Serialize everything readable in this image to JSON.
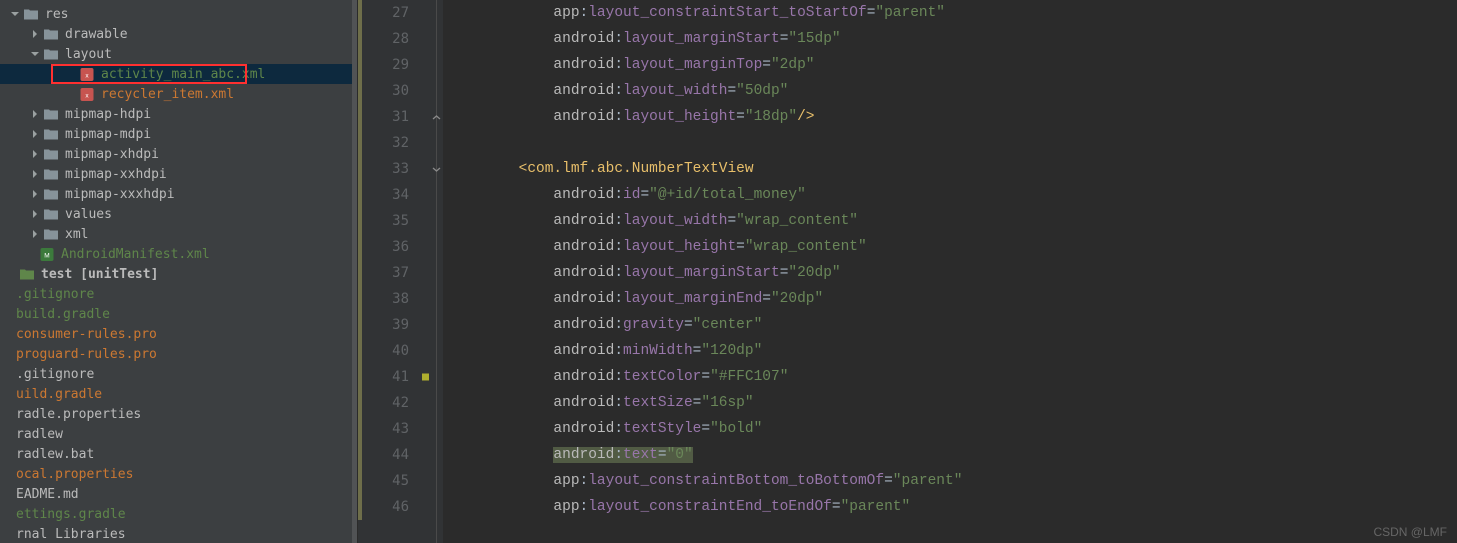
{
  "sidebar": {
    "items": [
      {
        "indent": 8,
        "chevron": "down",
        "icon": "folder",
        "label": "res"
      },
      {
        "indent": 28,
        "chevron": "right",
        "icon": "folder",
        "label": "drawable"
      },
      {
        "indent": 28,
        "chevron": "down",
        "icon": "folder",
        "label": "layout"
      },
      {
        "indent": 64,
        "chevron": "none",
        "icon": "xml-file",
        "label": "activity_main_abc.xml",
        "color": "green",
        "selected": true,
        "redbox": true
      },
      {
        "indent": 64,
        "chevron": "none",
        "icon": "xml-file",
        "label": "recycler_item.xml",
        "color": "orange"
      },
      {
        "indent": 28,
        "chevron": "right",
        "icon": "folder",
        "label": "mipmap-hdpi"
      },
      {
        "indent": 28,
        "chevron": "right",
        "icon": "folder",
        "label": "mipmap-mdpi"
      },
      {
        "indent": 28,
        "chevron": "right",
        "icon": "folder",
        "label": "mipmap-xhdpi"
      },
      {
        "indent": 28,
        "chevron": "right",
        "icon": "folder",
        "label": "mipmap-xxhdpi"
      },
      {
        "indent": 28,
        "chevron": "right",
        "icon": "folder",
        "label": "mipmap-xxxhdpi"
      },
      {
        "indent": 28,
        "chevron": "right",
        "icon": "folder",
        "label": "values"
      },
      {
        "indent": 28,
        "chevron": "right",
        "icon": "folder",
        "label": "xml"
      },
      {
        "indent": 24,
        "chevron": "none",
        "icon": "manifest",
        "label": "AndroidManifest.xml",
        "color": "green"
      },
      {
        "indent": 4,
        "chevron": "none",
        "icon": "folder-sm",
        "label": "test [unitTest]",
        "bold": true
      },
      {
        "indent": 0,
        "chevron": "none",
        "icon": "none",
        "label": ".gitignore",
        "color": "green"
      },
      {
        "indent": 0,
        "chevron": "none",
        "icon": "none",
        "label": "build.gradle",
        "color": "green"
      },
      {
        "indent": 0,
        "chevron": "none",
        "icon": "none",
        "label": "consumer-rules.pro",
        "color": "orange"
      },
      {
        "indent": 0,
        "chevron": "none",
        "icon": "none",
        "label": "proguard-rules.pro",
        "color": "orange"
      },
      {
        "indent": 0,
        "chevron": "none",
        "icon": "none",
        "label": ".gitignore"
      },
      {
        "indent": 0,
        "chevron": "none",
        "icon": "none",
        "label": "uild.gradle",
        "color": "orange"
      },
      {
        "indent": 0,
        "chevron": "none",
        "icon": "none",
        "label": "radle.properties"
      },
      {
        "indent": 0,
        "chevron": "none",
        "icon": "none",
        "label": "radlew"
      },
      {
        "indent": 0,
        "chevron": "none",
        "icon": "none",
        "label": "radlew.bat"
      },
      {
        "indent": 0,
        "chevron": "none",
        "icon": "none",
        "label": "ocal.properties",
        "color": "orange"
      },
      {
        "indent": 0,
        "chevron": "none",
        "icon": "none",
        "label": "EADME.md"
      },
      {
        "indent": 0,
        "chevron": "none",
        "icon": "none",
        "label": "ettings.gradle",
        "color": "green"
      },
      {
        "indent": 0,
        "chevron": "none",
        "icon": "none",
        "label": "rnal Libraries"
      }
    ]
  },
  "gutter": {
    "lines": [
      27,
      28,
      29,
      30,
      31,
      32,
      33,
      34,
      35,
      36,
      37,
      38,
      39,
      40,
      41,
      42,
      43,
      44,
      45,
      46
    ],
    "warnLine": 41,
    "collapseOpen": 31,
    "collapseStart": 33
  },
  "code": [
    {
      "indent": 12,
      "tokens": [
        {
          "t": "ns",
          "v": "app"
        },
        {
          "t": "eq",
          "v": ":"
        },
        {
          "t": "attr",
          "v": "layout_constraintStart_toStartOf"
        },
        {
          "t": "eq",
          "v": "="
        },
        {
          "t": "str",
          "v": "\"parent\""
        }
      ]
    },
    {
      "indent": 12,
      "tokens": [
        {
          "t": "ns",
          "v": "android"
        },
        {
          "t": "eq",
          "v": ":"
        },
        {
          "t": "attr",
          "v": "layout_marginStart"
        },
        {
          "t": "eq",
          "v": "="
        },
        {
          "t": "str",
          "v": "\"15dp\""
        }
      ]
    },
    {
      "indent": 12,
      "tokens": [
        {
          "t": "ns",
          "v": "android"
        },
        {
          "t": "eq",
          "v": ":"
        },
        {
          "t": "attr",
          "v": "layout_marginTop"
        },
        {
          "t": "eq",
          "v": "="
        },
        {
          "t": "str",
          "v": "\"2dp\""
        }
      ]
    },
    {
      "indent": 12,
      "tokens": [
        {
          "t": "ns",
          "v": "android"
        },
        {
          "t": "eq",
          "v": ":"
        },
        {
          "t": "attr",
          "v": "layout_width"
        },
        {
          "t": "eq",
          "v": "="
        },
        {
          "t": "str",
          "v": "\"50dp\""
        }
      ]
    },
    {
      "indent": 12,
      "tokens": [
        {
          "t": "ns",
          "v": "android"
        },
        {
          "t": "eq",
          "v": ":"
        },
        {
          "t": "attr",
          "v": "layout_height"
        },
        {
          "t": "eq",
          "v": "="
        },
        {
          "t": "str",
          "v": "\"18dp\""
        },
        {
          "t": "tag",
          "v": "/>"
        }
      ]
    },
    {
      "indent": 0,
      "tokens": []
    },
    {
      "indent": 8,
      "tokens": [
        {
          "t": "tag",
          "v": "<com.lmf.abc.NumberTextView"
        }
      ]
    },
    {
      "indent": 12,
      "tokens": [
        {
          "t": "ns",
          "v": "android"
        },
        {
          "t": "eq",
          "v": ":"
        },
        {
          "t": "attr",
          "v": "id"
        },
        {
          "t": "eq",
          "v": "="
        },
        {
          "t": "str",
          "v": "\"@+id/total_money\""
        }
      ]
    },
    {
      "indent": 12,
      "tokens": [
        {
          "t": "ns",
          "v": "android"
        },
        {
          "t": "eq",
          "v": ":"
        },
        {
          "t": "attr",
          "v": "layout_width"
        },
        {
          "t": "eq",
          "v": "="
        },
        {
          "t": "str",
          "v": "\"wrap_content\""
        }
      ]
    },
    {
      "indent": 12,
      "tokens": [
        {
          "t": "ns",
          "v": "android"
        },
        {
          "t": "eq",
          "v": ":"
        },
        {
          "t": "attr",
          "v": "layout_height"
        },
        {
          "t": "eq",
          "v": "="
        },
        {
          "t": "str",
          "v": "\"wrap_content\""
        }
      ]
    },
    {
      "indent": 12,
      "tokens": [
        {
          "t": "ns",
          "v": "android"
        },
        {
          "t": "eq",
          "v": ":"
        },
        {
          "t": "attr",
          "v": "layout_marginStart"
        },
        {
          "t": "eq",
          "v": "="
        },
        {
          "t": "str",
          "v": "\"20dp\""
        }
      ]
    },
    {
      "indent": 12,
      "tokens": [
        {
          "t": "ns",
          "v": "android"
        },
        {
          "t": "eq",
          "v": ":"
        },
        {
          "t": "attr",
          "v": "layout_marginEnd"
        },
        {
          "t": "eq",
          "v": "="
        },
        {
          "t": "str",
          "v": "\"20dp\""
        }
      ]
    },
    {
      "indent": 12,
      "tokens": [
        {
          "t": "ns",
          "v": "android"
        },
        {
          "t": "eq",
          "v": ":"
        },
        {
          "t": "attr",
          "v": "gravity"
        },
        {
          "t": "eq",
          "v": "="
        },
        {
          "t": "str",
          "v": "\"center\""
        }
      ]
    },
    {
      "indent": 12,
      "tokens": [
        {
          "t": "ns",
          "v": "android"
        },
        {
          "t": "eq",
          "v": ":"
        },
        {
          "t": "attr",
          "v": "minWidth"
        },
        {
          "t": "eq",
          "v": "="
        },
        {
          "t": "str",
          "v": "\"120dp\""
        }
      ]
    },
    {
      "indent": 12,
      "tokens": [
        {
          "t": "ns",
          "v": "android"
        },
        {
          "t": "eq",
          "v": ":"
        },
        {
          "t": "attr",
          "v": "textColor"
        },
        {
          "t": "eq",
          "v": "="
        },
        {
          "t": "str",
          "v": "\"#FFC107\""
        }
      ]
    },
    {
      "indent": 12,
      "tokens": [
        {
          "t": "ns",
          "v": "android"
        },
        {
          "t": "eq",
          "v": ":"
        },
        {
          "t": "attr",
          "v": "textSize"
        },
        {
          "t": "eq",
          "v": "="
        },
        {
          "t": "str",
          "v": "\"16sp\""
        }
      ]
    },
    {
      "indent": 12,
      "tokens": [
        {
          "t": "ns",
          "v": "android"
        },
        {
          "t": "eq",
          "v": ":"
        },
        {
          "t": "attr",
          "v": "textStyle"
        },
        {
          "t": "eq",
          "v": "="
        },
        {
          "t": "str",
          "v": "\"bold\""
        }
      ]
    },
    {
      "indent": 12,
      "sel": true,
      "tokens": [
        {
          "t": "ns",
          "v": "android"
        },
        {
          "t": "eq",
          "v": ":"
        },
        {
          "t": "attr",
          "v": "text"
        },
        {
          "t": "eq",
          "v": "="
        },
        {
          "t": "str",
          "v": "\"0\""
        }
      ]
    },
    {
      "indent": 12,
      "tokens": [
        {
          "t": "ns",
          "v": "app"
        },
        {
          "t": "eq",
          "v": ":"
        },
        {
          "t": "attr",
          "v": "layout_constraintBottom_toBottomOf"
        },
        {
          "t": "eq",
          "v": "="
        },
        {
          "t": "str",
          "v": "\"parent\""
        }
      ]
    },
    {
      "indent": 12,
      "tokens": [
        {
          "t": "ns",
          "v": "app"
        },
        {
          "t": "eq",
          "v": ":"
        },
        {
          "t": "attr",
          "v": "layout_constraintEnd_toEndOf"
        },
        {
          "t": "eq",
          "v": "="
        },
        {
          "t": "str",
          "v": "\"parent\""
        }
      ]
    }
  ],
  "watermark": "CSDN @LMF"
}
